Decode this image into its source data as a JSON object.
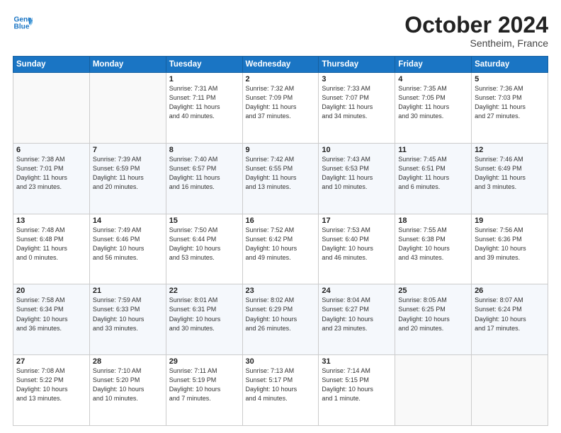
{
  "header": {
    "logo_line1": "General",
    "logo_line2": "Blue",
    "month": "October 2024",
    "location": "Sentheim, France"
  },
  "weekdays": [
    "Sunday",
    "Monday",
    "Tuesday",
    "Wednesday",
    "Thursday",
    "Friday",
    "Saturday"
  ],
  "weeks": [
    [
      {
        "day": "",
        "info": ""
      },
      {
        "day": "",
        "info": ""
      },
      {
        "day": "1",
        "info": "Sunrise: 7:31 AM\nSunset: 7:11 PM\nDaylight: 11 hours\nand 40 minutes."
      },
      {
        "day": "2",
        "info": "Sunrise: 7:32 AM\nSunset: 7:09 PM\nDaylight: 11 hours\nand 37 minutes."
      },
      {
        "day": "3",
        "info": "Sunrise: 7:33 AM\nSunset: 7:07 PM\nDaylight: 11 hours\nand 34 minutes."
      },
      {
        "day": "4",
        "info": "Sunrise: 7:35 AM\nSunset: 7:05 PM\nDaylight: 11 hours\nand 30 minutes."
      },
      {
        "day": "5",
        "info": "Sunrise: 7:36 AM\nSunset: 7:03 PM\nDaylight: 11 hours\nand 27 minutes."
      }
    ],
    [
      {
        "day": "6",
        "info": "Sunrise: 7:38 AM\nSunset: 7:01 PM\nDaylight: 11 hours\nand 23 minutes."
      },
      {
        "day": "7",
        "info": "Sunrise: 7:39 AM\nSunset: 6:59 PM\nDaylight: 11 hours\nand 20 minutes."
      },
      {
        "day": "8",
        "info": "Sunrise: 7:40 AM\nSunset: 6:57 PM\nDaylight: 11 hours\nand 16 minutes."
      },
      {
        "day": "9",
        "info": "Sunrise: 7:42 AM\nSunset: 6:55 PM\nDaylight: 11 hours\nand 13 minutes."
      },
      {
        "day": "10",
        "info": "Sunrise: 7:43 AM\nSunset: 6:53 PM\nDaylight: 11 hours\nand 10 minutes."
      },
      {
        "day": "11",
        "info": "Sunrise: 7:45 AM\nSunset: 6:51 PM\nDaylight: 11 hours\nand 6 minutes."
      },
      {
        "day": "12",
        "info": "Sunrise: 7:46 AM\nSunset: 6:49 PM\nDaylight: 11 hours\nand 3 minutes."
      }
    ],
    [
      {
        "day": "13",
        "info": "Sunrise: 7:48 AM\nSunset: 6:48 PM\nDaylight: 11 hours\nand 0 minutes."
      },
      {
        "day": "14",
        "info": "Sunrise: 7:49 AM\nSunset: 6:46 PM\nDaylight: 10 hours\nand 56 minutes."
      },
      {
        "day": "15",
        "info": "Sunrise: 7:50 AM\nSunset: 6:44 PM\nDaylight: 10 hours\nand 53 minutes."
      },
      {
        "day": "16",
        "info": "Sunrise: 7:52 AM\nSunset: 6:42 PM\nDaylight: 10 hours\nand 49 minutes."
      },
      {
        "day": "17",
        "info": "Sunrise: 7:53 AM\nSunset: 6:40 PM\nDaylight: 10 hours\nand 46 minutes."
      },
      {
        "day": "18",
        "info": "Sunrise: 7:55 AM\nSunset: 6:38 PM\nDaylight: 10 hours\nand 43 minutes."
      },
      {
        "day": "19",
        "info": "Sunrise: 7:56 AM\nSunset: 6:36 PM\nDaylight: 10 hours\nand 39 minutes."
      }
    ],
    [
      {
        "day": "20",
        "info": "Sunrise: 7:58 AM\nSunset: 6:34 PM\nDaylight: 10 hours\nand 36 minutes."
      },
      {
        "day": "21",
        "info": "Sunrise: 7:59 AM\nSunset: 6:33 PM\nDaylight: 10 hours\nand 33 minutes."
      },
      {
        "day": "22",
        "info": "Sunrise: 8:01 AM\nSunset: 6:31 PM\nDaylight: 10 hours\nand 30 minutes."
      },
      {
        "day": "23",
        "info": "Sunrise: 8:02 AM\nSunset: 6:29 PM\nDaylight: 10 hours\nand 26 minutes."
      },
      {
        "day": "24",
        "info": "Sunrise: 8:04 AM\nSunset: 6:27 PM\nDaylight: 10 hours\nand 23 minutes."
      },
      {
        "day": "25",
        "info": "Sunrise: 8:05 AM\nSunset: 6:25 PM\nDaylight: 10 hours\nand 20 minutes."
      },
      {
        "day": "26",
        "info": "Sunrise: 8:07 AM\nSunset: 6:24 PM\nDaylight: 10 hours\nand 17 minutes."
      }
    ],
    [
      {
        "day": "27",
        "info": "Sunrise: 7:08 AM\nSunset: 5:22 PM\nDaylight: 10 hours\nand 13 minutes."
      },
      {
        "day": "28",
        "info": "Sunrise: 7:10 AM\nSunset: 5:20 PM\nDaylight: 10 hours\nand 10 minutes."
      },
      {
        "day": "29",
        "info": "Sunrise: 7:11 AM\nSunset: 5:19 PM\nDaylight: 10 hours\nand 7 minutes."
      },
      {
        "day": "30",
        "info": "Sunrise: 7:13 AM\nSunset: 5:17 PM\nDaylight: 10 hours\nand 4 minutes."
      },
      {
        "day": "31",
        "info": "Sunrise: 7:14 AM\nSunset: 5:15 PM\nDaylight: 10 hours\nand 1 minute."
      },
      {
        "day": "",
        "info": ""
      },
      {
        "day": "",
        "info": ""
      }
    ]
  ]
}
